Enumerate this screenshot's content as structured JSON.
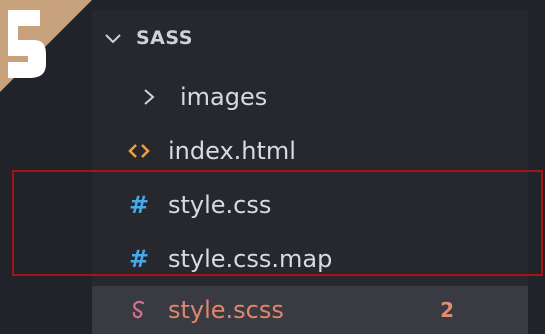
{
  "explorer": {
    "folder_name": "SASS",
    "items": [
      {
        "label": "images",
        "type": "folder",
        "icon": "chevron-right-icon"
      },
      {
        "label": "index.html",
        "type": "file",
        "icon": "html-code-icon"
      },
      {
        "label": "style.css",
        "type": "file",
        "icon": "css-hash-icon"
      },
      {
        "label": "style.css.map",
        "type": "file",
        "icon": "css-hash-icon"
      },
      {
        "label": "style.scss",
        "type": "file",
        "icon": "sass-icon",
        "badge": "2"
      }
    ]
  },
  "icons": {
    "hash_symbol": "#"
  },
  "colors": {
    "background": "#21232b",
    "panel": "#26282e",
    "selected_row": "#393a42",
    "highlight_box": "#a41414",
    "hash_icon": "#47a8ea",
    "html_icon": "#e8a33b",
    "sass_icon": "#d5708e"
  }
}
